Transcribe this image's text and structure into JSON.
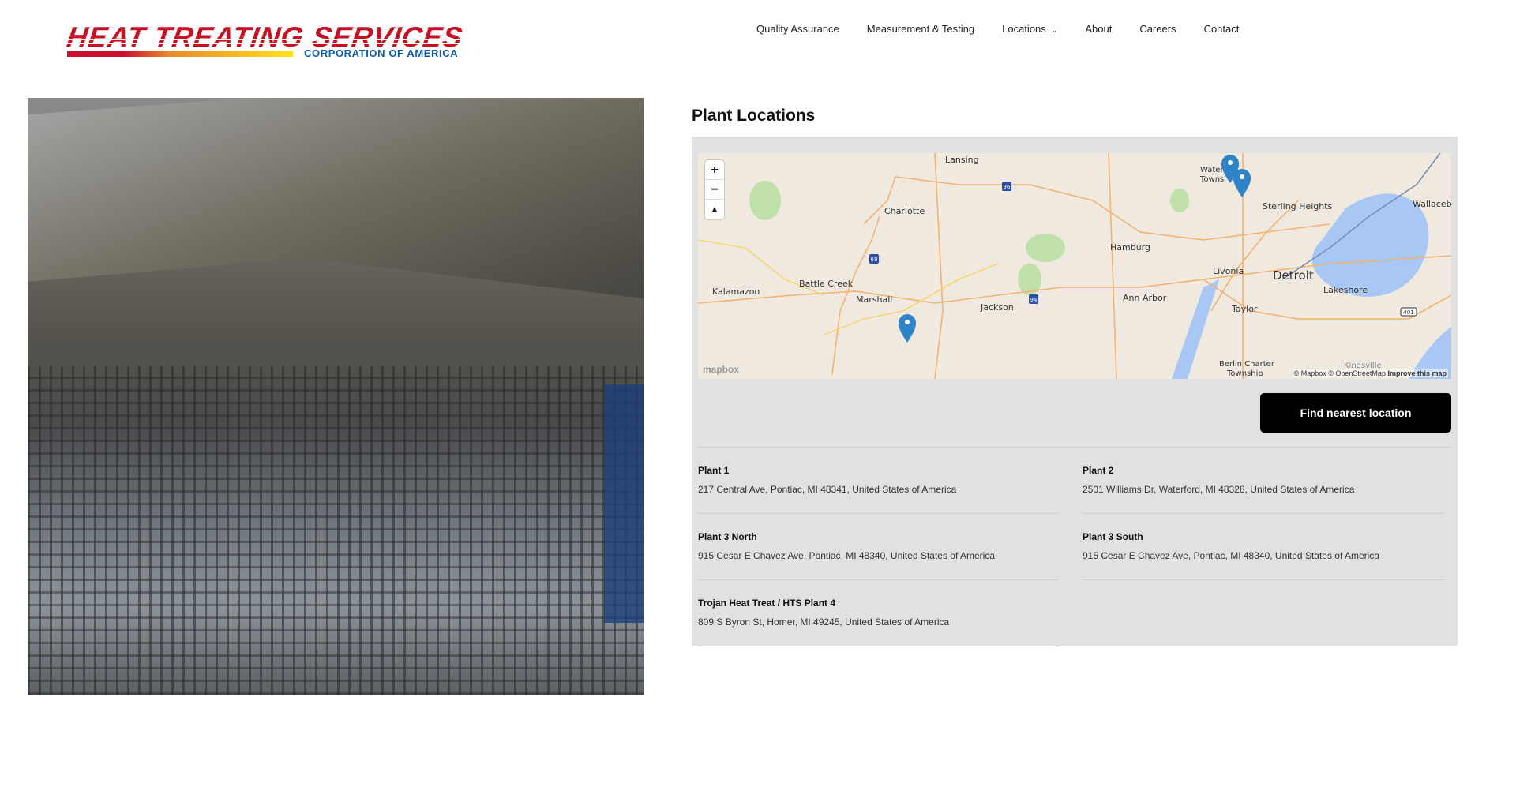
{
  "logo": {
    "main": "HEAT TREATING SERVICES",
    "sub": "CORPORATION OF AMERICA"
  },
  "nav": [
    {
      "label": "Quality Assurance"
    },
    {
      "label": "Measurement & Testing"
    },
    {
      "label": "Locations",
      "chevron": "⌄"
    },
    {
      "label": "About"
    },
    {
      "label": "Careers"
    },
    {
      "label": "Contact"
    }
  ],
  "section_title": "Plant Locations",
  "map": {
    "zoom_in": "+",
    "zoom_out": "−",
    "compass": "▲",
    "labels": {
      "lansing": "Lansing",
      "charlotte": "Charlotte",
      "battle_creek": "Battle Creek",
      "kalamazoo": "Kalamazoo",
      "marshall": "Marshall",
      "jackson": "Jackson",
      "ann_arbor": "Ann Arbor",
      "hamburg": "Hamburg",
      "livonia": "Livonia",
      "detroit": "Detroit",
      "taylor": "Taylor",
      "lakeshore": "Lakeshore",
      "sterling_heights": "Sterling Heights",
      "wallaceburg": "Wallacebu",
      "waterford1": "Water",
      "waterford2": "Towns",
      "berlin1": "Berlin Charter",
      "berlin2": "Township",
      "kingsville": "Kingsville"
    },
    "shields": {
      "i96": "96",
      "i69": "69",
      "i94": "94",
      "hwy401": "401"
    },
    "logo": "mapbox",
    "attribution": "© Mapbox © OpenStreetMap",
    "improve": "Improve this map",
    "marker_color": "#2f84c8"
  },
  "find_button": "Find nearest location",
  "locations": [
    {
      "name": "Plant 1",
      "address": "217 Central Ave, Pontiac, MI 48341, United States of America"
    },
    {
      "name": "Plant 2",
      "address": "2501 Williams Dr, Waterford, MI 48328, United States of America"
    },
    {
      "name": "Plant 3 North",
      "address": "915 Cesar E Chavez Ave, Pontiac, MI 48340, United States of America"
    },
    {
      "name": "Plant 3 South",
      "address": "915 Cesar E Chavez Ave, Pontiac, MI 48340, United States of America"
    },
    {
      "name": "Trojan Heat Treat / HTS Plant 4",
      "address": "809 S Byron St, Homer, MI 49245, United States of America"
    }
  ]
}
